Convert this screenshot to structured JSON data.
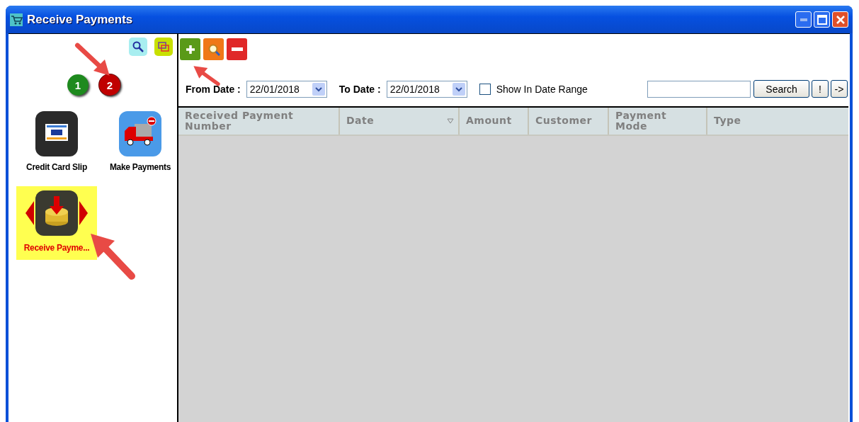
{
  "window": {
    "title": "Receive Payments"
  },
  "pages": [
    {
      "label": "1",
      "color": "#1e8a1e",
      "selected": false
    },
    {
      "label": "2",
      "color": "#c00000",
      "selected": true
    }
  ],
  "modules": [
    {
      "label": "Credit Card Slip",
      "kind": "card",
      "selected": false
    },
    {
      "label": "Make Payments",
      "kind": "truck",
      "selected": false
    },
    {
      "label": "Receive Payme...",
      "kind": "coins",
      "selected": true
    }
  ],
  "filters": {
    "from_label": "From Date :",
    "from_value": "22/01/2018",
    "to_label": "To Date :",
    "to_value": "22/01/2018",
    "range_label": "Show In Date Range",
    "range_checked": false
  },
  "search": {
    "button": "Search",
    "extra_buttons": [
      "!",
      "->"
    ]
  },
  "table": {
    "columns": [
      {
        "label": "Received Payment Number",
        "sorted": false
      },
      {
        "label": "Date",
        "sorted": true
      },
      {
        "label": "Amount",
        "sorted": false
      },
      {
        "label": "Customer",
        "sorted": false
      },
      {
        "label": "Payment Mode",
        "sorted": false
      },
      {
        "label": "Type",
        "sorted": false
      }
    ]
  }
}
